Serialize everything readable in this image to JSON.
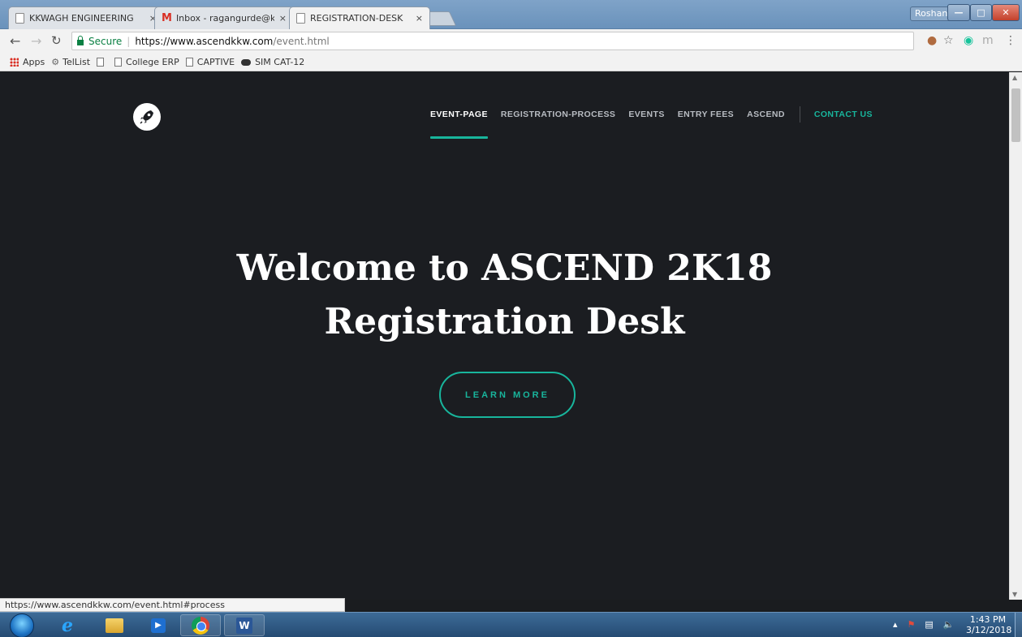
{
  "browser": {
    "tabs": [
      {
        "title": "KKWAGH ENGINEERING",
        "close": "×"
      },
      {
        "title": "Inbox - ragangurde@kk",
        "close": "×"
      },
      {
        "title": "REGISTRATION-DESK",
        "close": "×"
      }
    ],
    "profile_name": "Roshan",
    "secure_label": "Secure",
    "url_host": "https://www.ascendkkw.com",
    "url_path": "/event.html",
    "bookmarks": [
      "Apps",
      "TelList",
      "College ERP",
      "CAPTIVE",
      "SIM CAT-12"
    ],
    "status_url": "https://www.ascendkkw.com/event.html#process"
  },
  "site": {
    "nav": [
      "EVENT-PAGE",
      "REGISTRATION-PROCESS",
      "EVENTS",
      "ENTRY FEES",
      "ASCEND"
    ],
    "contact": "CONTACT US",
    "hero_line1": "Welcome to ASCEND 2K18",
    "hero_line2": "Registration Desk",
    "cta": "LEARN MORE"
  },
  "taskbar": {
    "time": "1:43 PM",
    "date": "3/12/2018"
  },
  "colors": {
    "accent": "#18b59c",
    "page_bg": "#1b1d21"
  }
}
